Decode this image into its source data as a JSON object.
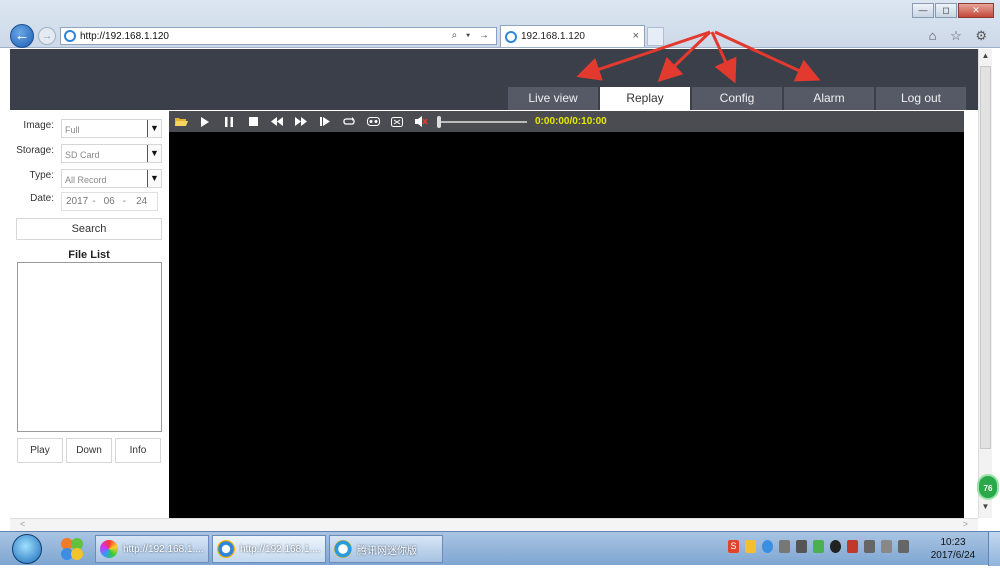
{
  "browser": {
    "url": "http://192.168.1.120",
    "tab_title": "192.168.1.120",
    "close_tab": "×",
    "addr_tools": "⌕ ▾ →",
    "right_icons": "⌂ ☆ ⚙",
    "win_min": "—",
    "win_max": "◻",
    "win_close": "✕"
  },
  "nav": {
    "tabs": [
      "Live view",
      "Replay",
      "Config",
      "Alarm",
      "Log out"
    ],
    "active_index": 1
  },
  "search_panel": {
    "image_label": "Image:",
    "image_value": "Full",
    "storage_label": "Storage:",
    "storage_value": "SD Card",
    "type_label": "Type:",
    "type_value": "All Record",
    "date_label": "Date:",
    "date_year": "2017",
    "date_month": "06",
    "date_day": "24",
    "date_sep": "-",
    "search_button": "Search",
    "file_list_title": "File List",
    "play_button": "Play",
    "down_button": "Down",
    "info_button": "Info"
  },
  "player": {
    "timecode": "0:00:00/0:10:00",
    "progress": 0
  },
  "taskbar": {
    "items": [
      "http://192.168.1....",
      "http://192.168.1....",
      "腾讯网迷你版"
    ],
    "active_index": 1,
    "time": "10:23",
    "date": "2017/6/24"
  },
  "badge": "76",
  "colors": {
    "header": "#3b3f4a",
    "tab_inactive": "#555a66",
    "arrow": "#e23a2e",
    "timecode": "#e8e800"
  }
}
